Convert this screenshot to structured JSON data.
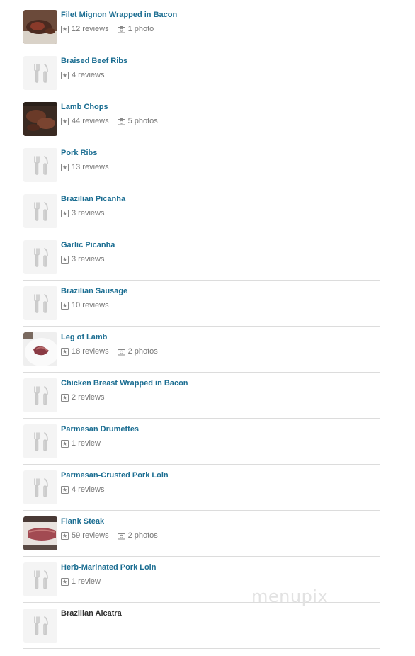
{
  "watermark": "menupix",
  "items": [
    {
      "title": "Filet Mignon Wrapped in Bacon",
      "reviews": "12 reviews",
      "photos": "1 photo",
      "thumb": "steak-bacon-photo",
      "link": true
    },
    {
      "title": "Braised Beef Ribs",
      "reviews": "4 reviews",
      "photos": "",
      "thumb": "utensils-placeholder",
      "link": true
    },
    {
      "title": "Lamb Chops",
      "reviews": "44 reviews",
      "photos": "5 photos",
      "thumb": "lamb-chops-photo",
      "link": true
    },
    {
      "title": "Pork Ribs",
      "reviews": "13 reviews",
      "photos": "",
      "thumb": "utensils-placeholder",
      "link": true
    },
    {
      "title": "Brazilian Picanha",
      "reviews": "3 reviews",
      "photos": "",
      "thumb": "utensils-placeholder",
      "link": true
    },
    {
      "title": "Garlic Picanha",
      "reviews": "3 reviews",
      "photos": "",
      "thumb": "utensils-placeholder",
      "link": true
    },
    {
      "title": "Brazilian Sausage",
      "reviews": "10 reviews",
      "photos": "",
      "thumb": "utensils-placeholder",
      "link": true
    },
    {
      "title": "Leg of Lamb",
      "reviews": "18 reviews",
      "photos": "2 photos",
      "thumb": "leg-of-lamb-photo",
      "link": true
    },
    {
      "title": "Chicken Breast Wrapped in Bacon",
      "reviews": "2 reviews",
      "photos": "",
      "thumb": "utensils-placeholder",
      "link": true
    },
    {
      "title": "Parmesan Drumettes",
      "reviews": "1 review",
      "photos": "",
      "thumb": "utensils-placeholder",
      "link": true
    },
    {
      "title": "Parmesan-Crusted Pork Loin",
      "reviews": "4 reviews",
      "photos": "",
      "thumb": "utensils-placeholder",
      "link": true
    },
    {
      "title": "Flank Steak",
      "reviews": "59 reviews",
      "photos": "2 photos",
      "thumb": "flank-steak-photo",
      "link": true
    },
    {
      "title": "Herb-Marinated Pork Loin",
      "reviews": "1 review",
      "photos": "",
      "thumb": "utensils-placeholder",
      "link": true
    },
    {
      "title": "Brazilian Alcatra",
      "reviews": "",
      "photos": "",
      "thumb": "utensils-placeholder",
      "link": false
    }
  ]
}
